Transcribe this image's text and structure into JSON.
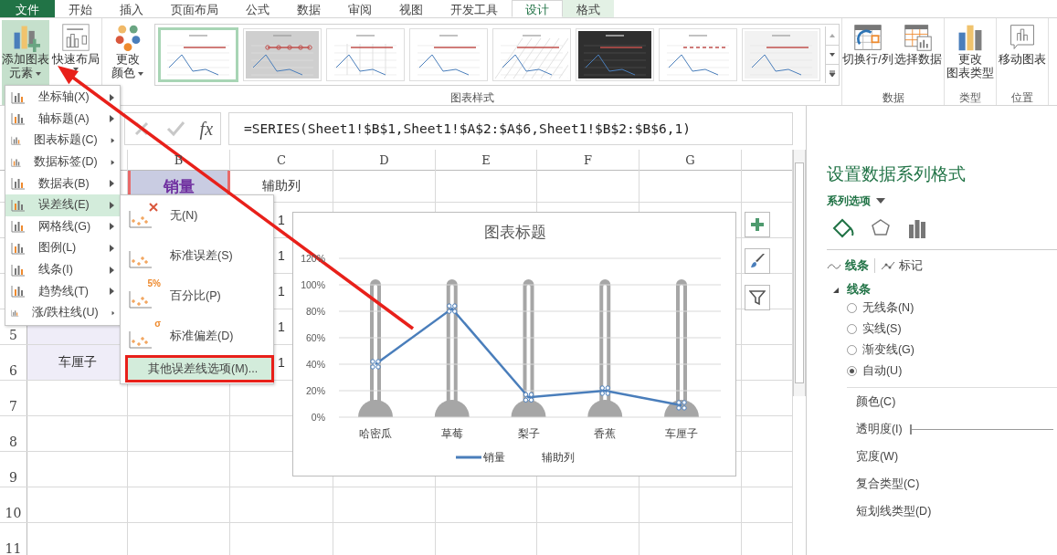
{
  "ribbon_tabs": [
    {
      "label": "文件",
      "kind": "file",
      "selected": false
    },
    {
      "label": "开始",
      "kind": "normal",
      "selected": false
    },
    {
      "label": "插入",
      "kind": "normal",
      "selected": false
    },
    {
      "label": "页面布局",
      "kind": "normal",
      "selected": false
    },
    {
      "label": "公式",
      "kind": "normal",
      "selected": false
    },
    {
      "label": "数据",
      "kind": "normal",
      "selected": false
    },
    {
      "label": "审阅",
      "kind": "normal",
      "selected": false
    },
    {
      "label": "视图",
      "kind": "normal",
      "selected": false
    },
    {
      "label": "开发工具",
      "kind": "normal",
      "selected": false
    },
    {
      "label": "设计",
      "kind": "context",
      "selected": true
    },
    {
      "label": "格式",
      "kind": "context",
      "selected": false
    }
  ],
  "ribbon_groups": [
    {
      "buttons": [
        {
          "lines": [
            "添加图表",
            "元素"
          ],
          "kind": "add-element",
          "dropdown": true,
          "selected": true
        },
        {
          "lines": [
            "快速布局"
          ],
          "kind": "quick-layout",
          "dropdown": true,
          "selected": false
        }
      ]
    },
    {
      "label": "图表样式",
      "buttons": [
        {
          "lines": [
            "更改",
            "颜色"
          ],
          "kind": "colors",
          "dropdown": true,
          "selected": false
        }
      ],
      "gallery": [
        {
          "kind": "plain",
          "selected": true
        },
        {
          "kind": "shaded",
          "selected": false
        },
        {
          "kind": "columns",
          "selected": false
        },
        {
          "kind": "plain",
          "selected": false
        },
        {
          "kind": "hatched",
          "selected": false
        },
        {
          "kind": "dark",
          "selected": false
        },
        {
          "kind": "dashed",
          "selected": false
        },
        {
          "kind": "banded",
          "selected": false
        }
      ]
    },
    {
      "label": "数据",
      "buttons": [
        {
          "lines": [
            "切换行/列"
          ],
          "kind": "switch",
          "dropdown": false,
          "selected": false
        },
        {
          "lines": [
            "选择数据"
          ],
          "kind": "select-data",
          "dropdown": false,
          "selected": false
        }
      ]
    },
    {
      "label": "类型",
      "buttons": [
        {
          "lines": [
            "更改",
            "图表类型"
          ],
          "kind": "chart-type",
          "dropdown": false,
          "selected": false
        }
      ]
    },
    {
      "label": "位置",
      "buttons": [
        {
          "lines": [
            "移动图表"
          ],
          "kind": "move",
          "dropdown": false,
          "selected": false
        }
      ]
    }
  ],
  "formula_bar": {
    "function_label": "fx",
    "formula": "=SERIES(Sheet1!$B$1,Sheet1!$A$2:$A$6,Sheet1!$B$2:$B$6,1)"
  },
  "sheet": {
    "columns": [
      "B",
      "C",
      "D",
      "E",
      "F",
      "G"
    ],
    "rows": [
      {
        "cells": [
          {
            "kind": "empty"
          },
          {
            "text": "销量",
            "kind": "series-name"
          },
          {
            "text": "辅助列",
            "kind": "plain"
          }
        ]
      },
      {
        "cells": [
          {
            "kind": "empty"
          },
          {
            "kind": "empty"
          },
          {
            "text": "1",
            "kind": "plain"
          }
        ]
      },
      {
        "cells": [
          {
            "kind": "empty"
          },
          {
            "kind": "empty"
          },
          {
            "text": "1",
            "kind": "plain"
          }
        ]
      },
      {
        "cells": [
          {
            "kind": "empty"
          },
          {
            "kind": "empty"
          },
          {
            "text": "1",
            "kind": "plain"
          }
        ]
      },
      {
        "number": "5",
        "cells": [
          {
            "kind": "category"
          },
          {
            "kind": "empty"
          },
          {
            "text": "1",
            "kind": "plain"
          }
        ]
      },
      {
        "number": "6",
        "cells": [
          {
            "text": "车厘子",
            "kind": "category"
          },
          {
            "kind": "empty"
          },
          {
            "text": "1",
            "kind": "plain"
          }
        ]
      },
      {
        "number": "7"
      },
      {
        "number": "8"
      },
      {
        "number": "9"
      },
      {
        "number": "10"
      },
      {
        "number": "11"
      }
    ]
  },
  "chart": {
    "title": "图表标题",
    "second_legend_label": "辅助列",
    "chart_data": {
      "type": "line",
      "grid": true,
      "categories": [
        "哈密瓜",
        "草莓",
        "梨子",
        "香蕉",
        "车厘子"
      ],
      "ylim": [
        0,
        1.2
      ],
      "yticks": [
        {
          "value": 0,
          "label": "0%"
        },
        {
          "value": 0.2,
          "label": "20%"
        },
        {
          "value": 0.4,
          "label": "40%"
        },
        {
          "value": 0.6,
          "label": "60%"
        },
        {
          "value": 0.8,
          "label": "80%"
        },
        {
          "value": 1,
          "label": "100%"
        },
        {
          "value": 1.2,
          "label": "120%"
        }
      ],
      "series": [
        {
          "name": "销量",
          "color": "#4a7ebb",
          "values": [
            0.4,
            0.82,
            0.15,
            0.2,
            0.09
          ]
        }
      ]
    },
    "tools": [
      {
        "kind": "add"
      },
      {
        "kind": "style"
      },
      {
        "kind": "filter"
      }
    ]
  },
  "element_menu": {
    "items": [
      {
        "label": "坐标轴(X)",
        "selected": false
      },
      {
        "label": "轴标题(A)",
        "selected": false
      },
      {
        "label": "图表标题(C)",
        "selected": false
      },
      {
        "label": "数据标签(D)",
        "selected": false
      },
      {
        "label": "数据表(B)",
        "selected": false
      },
      {
        "label": "误差线(E)",
        "selected": true
      },
      {
        "label": "网格线(G)",
        "selected": false
      },
      {
        "label": "图例(L)",
        "selected": false
      },
      {
        "label": "线条(I)",
        "selected": false
      },
      {
        "label": "趋势线(T)",
        "selected": false
      },
      {
        "label": "涨/跌柱线(U)",
        "selected": false
      }
    ],
    "submenu": [
      {
        "label": "无(N)",
        "kind": "none",
        "selected": false
      },
      {
        "label": "标准误差(S)",
        "kind": "standard-error",
        "selected": false
      },
      {
        "label": "百分比(P)",
        "kind": "percent",
        "badge": "5%",
        "selected": false
      },
      {
        "label": "标准偏差(D)",
        "kind": "standard-deviation",
        "badge": "σ",
        "selected": false
      },
      {
        "label": "其他误差线选项(M)...",
        "kind": "more",
        "selected": true
      }
    ]
  },
  "format_pane": {
    "title": "设置数据系列格式",
    "options_label": "系列选项",
    "icon_tabs": [
      {
        "kind": "fill",
        "selected": true
      },
      {
        "kind": "effects",
        "selected": false
      },
      {
        "kind": "series",
        "selected": false
      }
    ],
    "sub_tabs": [
      {
        "label": "线条",
        "kind": "line",
        "selected": true
      },
      {
        "label": "标记",
        "kind": "marker",
        "selected": false
      }
    ],
    "section": {
      "label": "线条",
      "expanded": true
    },
    "line_options": [
      {
        "label": "无线条(N)",
        "selected": false
      },
      {
        "label": "实线(S)",
        "selected": false
      },
      {
        "label": "渐变线(G)",
        "selected": false
      },
      {
        "label": "自动(U)",
        "selected": true
      }
    ],
    "properties": [
      {
        "label": "颜色(C)",
        "kind": "plain"
      },
      {
        "label": "透明度(I)",
        "kind": "slider",
        "level": 0
      },
      {
        "label": "宽度(W)",
        "kind": "plain"
      },
      {
        "label": "复合类型(C)",
        "kind": "plain"
      },
      {
        "label": "短划线类型(D)",
        "kind": "plain"
      }
    ]
  }
}
